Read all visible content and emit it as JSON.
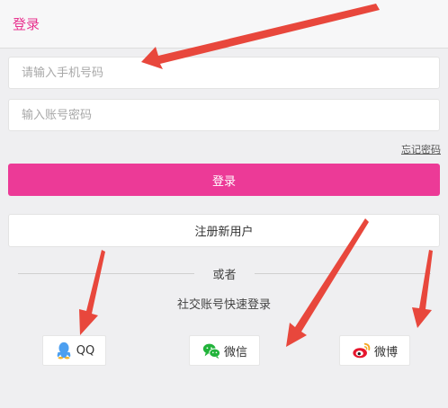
{
  "header": {
    "title": "登录"
  },
  "form": {
    "phone_placeholder": "请输入手机号码",
    "password_placeholder": "输入账号密码",
    "forgot_label": "忘记密码",
    "login_label": "登录",
    "register_label": "注册新用户"
  },
  "divider": {
    "text": "或者"
  },
  "social": {
    "title": "社交账号快速登录",
    "items": [
      {
        "label": "QQ",
        "icon": "qq-penguin-icon",
        "color": "#4c9ff0"
      },
      {
        "label": "微信",
        "icon": "wechat-icon",
        "color": "#21b33a"
      },
      {
        "label": "微博",
        "icon": "weibo-icon",
        "color": "#e6162d"
      }
    ]
  },
  "colors": {
    "accent": "#ec3a97",
    "title": "#e8338f",
    "annotation_arrow": "#e8473c",
    "background": "#efeff1"
  }
}
